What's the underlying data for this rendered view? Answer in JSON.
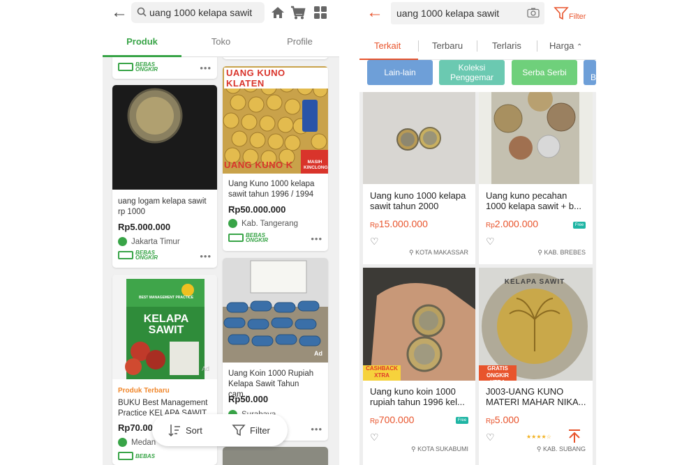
{
  "left": {
    "search_value": "uang 1000 kelapa sawit",
    "tabs": [
      {
        "label": "Produk"
      },
      {
        "label": "Toko"
      },
      {
        "label": "Profile"
      }
    ],
    "free_shipping_line1": "BEBAS",
    "free_shipping_line2": "ONGKIR",
    "more_label": "•••",
    "products": [
      {
        "title": "uang logam kelapa sawit rp 1000",
        "price": "Rp5.000.000",
        "location": "Jakarta Timur"
      },
      {
        "title": "Uang Kuno 1000 kelapa sawit tahun 1996 / 1994 ...",
        "price": "Rp50.000.000",
        "location": "Kab. Tangerang",
        "image_text": "UANG KUNO KLATEN",
        "image_text2": "UANG KUNO K",
        "image_badge": "MASIH KINCLONG"
      },
      {
        "tag": "Produk Terbaru",
        "title": "BUKU Best Management Practice KELAPA SAWIT",
        "price": "Rp70.000",
        "location": "Medan",
        "image_text": "KELAPA SAWIT",
        "image_subtext": "BEST MANAGEMENT PRACTICE",
        "ad": "Ad"
      },
      {
        "title": "Uang Koin 1000 Rupiah Kelapa Sawit Tahun cam...",
        "price": "Rp50.000",
        "location": "Surabaya",
        "ad": "Ad"
      }
    ],
    "sort_label": "Sort",
    "filter_label": "Filter"
  },
  "right": {
    "search_value": "uang 1000 kelapa sawit",
    "filter_label": "Filter",
    "tabs": [
      {
        "label": "Terkait"
      },
      {
        "label": "Terbaru"
      },
      {
        "label": "Terlaris"
      },
      {
        "label": "Harga"
      }
    ],
    "chips": [
      {
        "label": "Lain-lain"
      },
      {
        "label": "Koleksi Penggemar"
      },
      {
        "label": "Serba Serbi"
      },
      {
        "label": "B"
      }
    ],
    "products": [
      {
        "title": "Uang kuno 1000 kelapa sawit tahun 2000",
        "currency": "Rp",
        "price": "15.000.000",
        "location": "KOTA MAKASSAR"
      },
      {
        "title": "Uang kuno pecahan 1000 kelapa sawit + b...",
        "currency": "Rp",
        "price": "2.000.000",
        "location": "KAB. BREBES",
        "free_shipping": "Free"
      },
      {
        "title": "Uang kuno koin 1000 rupiah tahun 1996 kel...",
        "currency": "Rp",
        "price": "700.000",
        "location": "KOTA SUKABUMI",
        "promo": "CASHBACK XTRA",
        "free_shipping": "Free"
      },
      {
        "title": "J003-UANG KUNO MATERI MAHAR NIKA...",
        "currency": "Rp",
        "price": "5.000",
        "location": "KAB. SUBANG",
        "promo": "GRATIS ONGKIR XTRA",
        "coin_text": "KELAPA SAWIT",
        "rating_stars": 4
      }
    ],
    "colors": {
      "accent": "#e8542c",
      "chip_blue": "#6e9fd8",
      "chip_teal": "#6bc9b1",
      "chip_green": "#6fd07b"
    }
  }
}
